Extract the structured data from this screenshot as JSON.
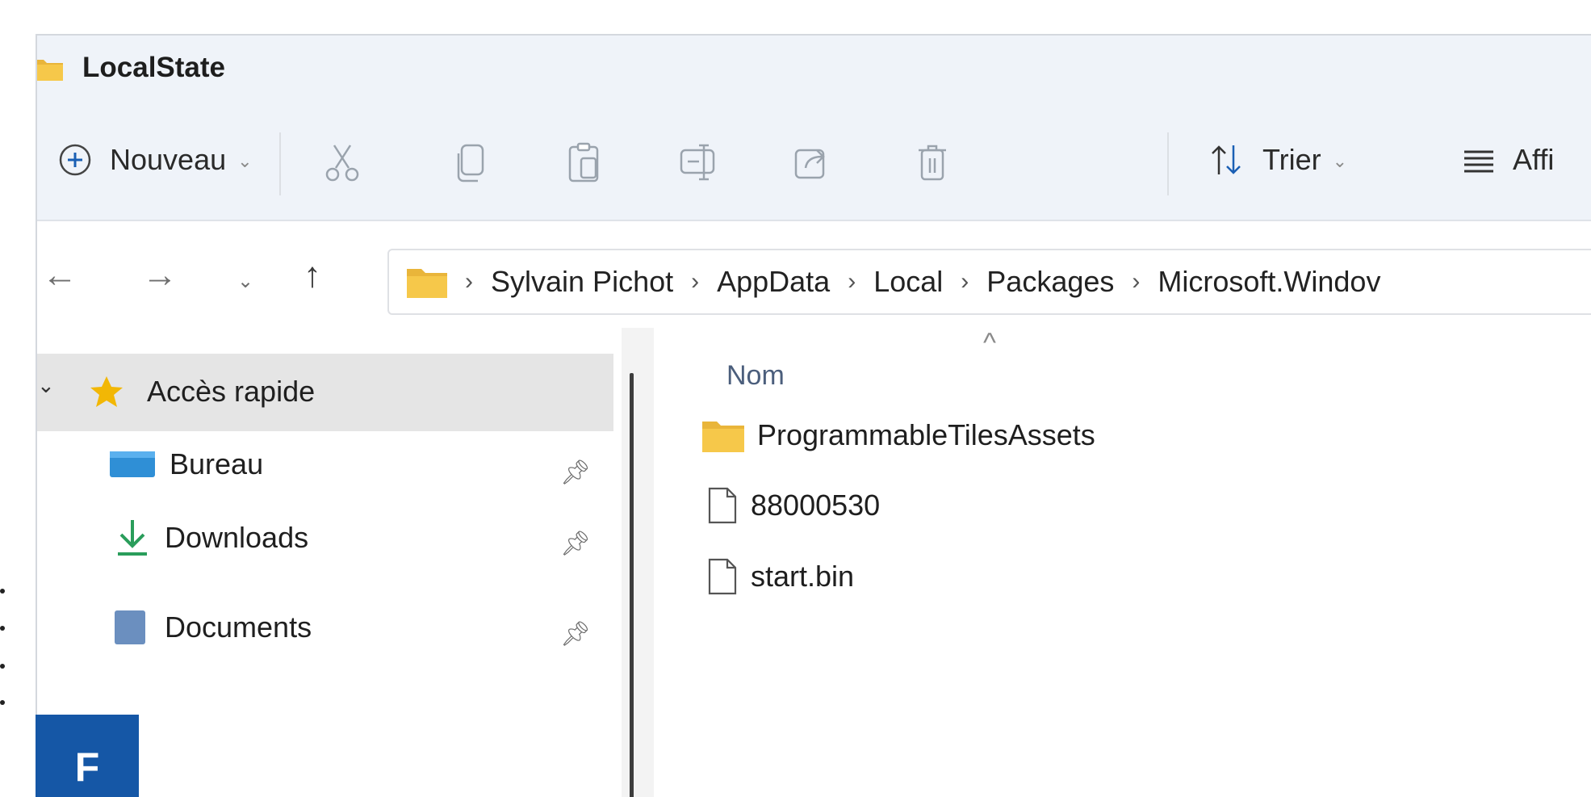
{
  "window": {
    "title": "LocalState"
  },
  "commandbar": {
    "new_label": "Nouveau",
    "sort_label": "Trier",
    "view_label": "Affi",
    "tools": [
      "cut-icon",
      "copy-icon",
      "paste-icon",
      "rename-icon",
      "share-icon",
      "delete-icon"
    ]
  },
  "address": {
    "breadcrumbs": [
      "Sylvain Pichot",
      "AppData",
      "Local",
      "Packages",
      "Microsoft.Windov"
    ],
    "separator": "›"
  },
  "sidebar": {
    "quick_access": "Accès rapide",
    "items": [
      {
        "label": "Bureau",
        "icon": "desktop-icon",
        "pinned": true
      },
      {
        "label": "Downloads",
        "icon": "download-icon",
        "pinned": true
      },
      {
        "label": "Documents",
        "icon": "documents-icon",
        "pinned": true
      }
    ]
  },
  "content": {
    "column_header": "Nom",
    "files": [
      {
        "name": "ProgrammableTilesAssets",
        "type": "folder"
      },
      {
        "name": "88000530",
        "type": "file"
      },
      {
        "name": "start.bin",
        "type": "file"
      }
    ]
  },
  "badge": {
    "letter": "F"
  },
  "colors": {
    "accent": "#1557a6",
    "folder": "#f2c23c",
    "bar": "#eff3f9"
  }
}
